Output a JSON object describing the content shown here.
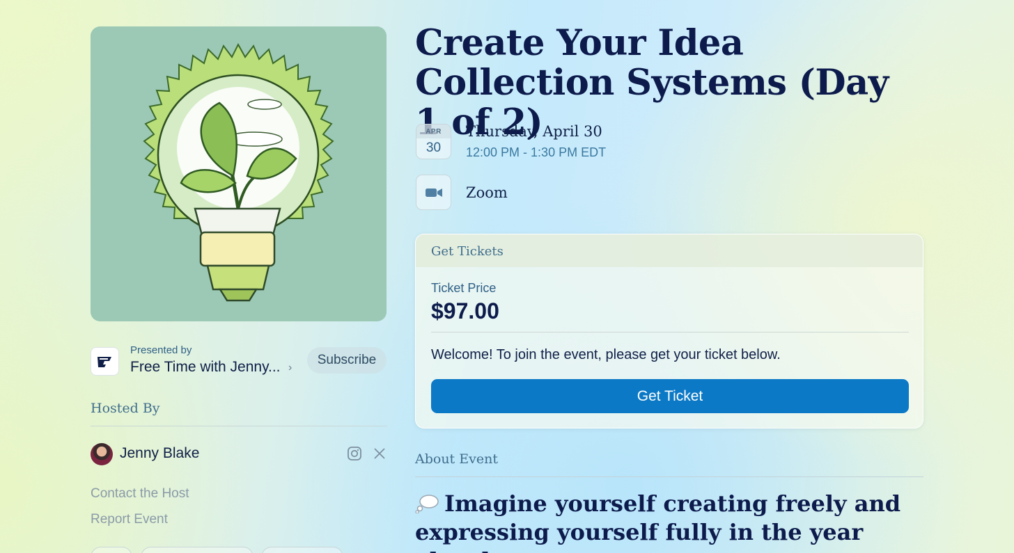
{
  "event": {
    "title": "Create Your Idea Collection Systems (Day 1 of 2)",
    "date": {
      "month": "APR",
      "day": "30",
      "full": "Thursday, April 30",
      "time": "12:00 PM - 1:30 PM EDT"
    },
    "location": {
      "icon": "video-camera-icon",
      "label": "Zoom"
    }
  },
  "presenter": {
    "prefix": "Presented by",
    "name": "Free Time with Jenny...",
    "subscribe_label": "Subscribe"
  },
  "host": {
    "section_title": "Hosted By",
    "name": "Jenny Blake",
    "social_icons": [
      "instagram-icon",
      "x-icon"
    ],
    "contact_label": "Contact the Host",
    "report_label": "Report Event"
  },
  "tickets": {
    "header": "Get Tickets",
    "price_label": "Ticket Price",
    "price": "$97.00",
    "welcome": "Welcome! To join the event, please get your ticket below.",
    "button_label": "Get Ticket"
  },
  "about": {
    "section_title": "About Event",
    "heading_icon": "thought-balloon-icon",
    "heading": "Imagine yourself creating freely and expressing yourself fully in the year ahead"
  },
  "colors": {
    "primary_button": "#0b79c6",
    "title_text": "#0d1b4c",
    "accent_text": "#3f6d8c",
    "cover_background": "#9cc9b5"
  }
}
